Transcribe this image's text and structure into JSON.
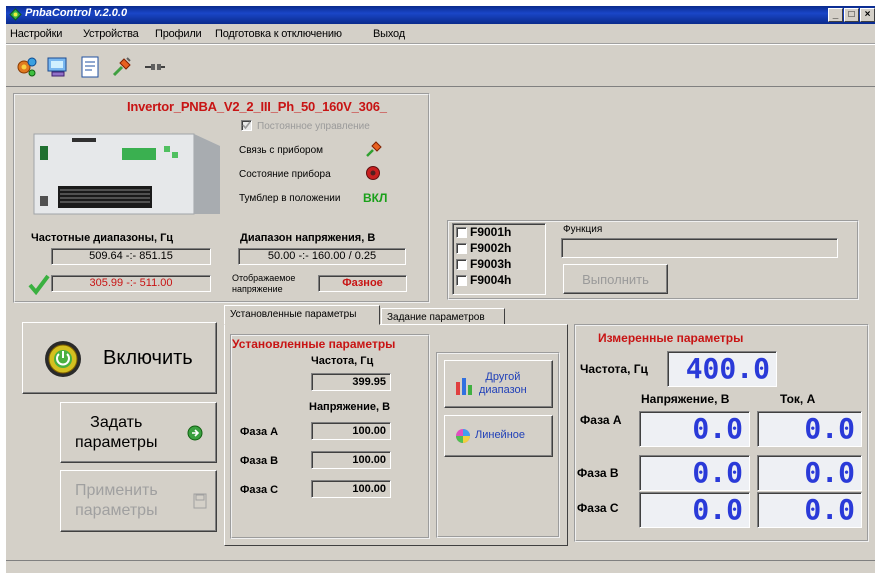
{
  "window": {
    "title": "PnbaControl v.2.0.0",
    "minimize_label": "_",
    "maximize_label": "□",
    "close_label": "×"
  },
  "menu": {
    "items": [
      "Настройки",
      "Устройства",
      "Профили",
      "Подготовка к отключению",
      "Выход"
    ]
  },
  "toolbar": {
    "icons": [
      "gear-network-icon",
      "computer-icon",
      "document-icon",
      "connect-plug-icon",
      "disconnect-plug-icon"
    ]
  },
  "device": {
    "name": "Invertor_PNBA_V2_2_III_Ph_50_160V_306_",
    "remote_control_label": "Постоянное управление",
    "connection_label": "Связь с прибором",
    "state_label": "Состояние прибора",
    "toggle_label": "Тумблер в положении",
    "toggle_value": "ВКЛ"
  },
  "ranges": {
    "freq_title": "Частотные диапазоны, Гц",
    "freq_range_1": "509.64 -:- 851.15",
    "freq_range_2": "305.99 -:- 511.00",
    "voltage_title": "Диапазон напряжения, В",
    "voltage_range": "50.00 -:- 160.00 / 0.25",
    "displayed_label_1": "Отображаемое",
    "displayed_label_2": "напряжение",
    "displayed_value": "Фазное"
  },
  "functions": {
    "items": [
      "F9001h",
      "F9002h",
      "F9003h",
      "F9004h"
    ],
    "field_label": "Функция",
    "field_value": "",
    "execute_label": "Выполнить"
  },
  "buttons": {
    "power_on": "Включить",
    "set_params_1": "Задать",
    "set_params_2": "параметры",
    "apply_params_1": "Применить",
    "apply_params_2": "параметры"
  },
  "tabs": {
    "active": "Установленные параметры",
    "inactive": "Задание параметров"
  },
  "set_params": {
    "title": "Установленные параметры",
    "freq_label": "Частота, Гц",
    "freq_value": "399.95",
    "voltage_label": "Напряжение, В",
    "phases": [
      {
        "label": "Фаза А",
        "value": "100.00"
      },
      {
        "label": "Фаза В",
        "value": "100.00"
      },
      {
        "label": "Фаза С",
        "value": "100.00"
      }
    ],
    "other_range_1": "Другой",
    "other_range_2": "диапазон",
    "linear_label": "Линейное"
  },
  "measured": {
    "title": "Измеренные параметры",
    "freq_label": "Частота, Гц",
    "freq_value": "400.0",
    "voltage_header": "Напряжение, В",
    "current_header": "Ток, А",
    "phases": [
      {
        "label": "Фаза А",
        "voltage": "0.0",
        "current": "0.0"
      },
      {
        "label": "Фаза В",
        "voltage": "0.0",
        "current": "0.0"
      },
      {
        "label": "Фаза С",
        "voltage": "0.0",
        "current": "0.0"
      }
    ]
  },
  "colors": {
    "accent_red": "#c81414",
    "lcd_blue": "#2a3ad8",
    "status_green": "#1aa01a",
    "face": "#d4d0c8"
  }
}
